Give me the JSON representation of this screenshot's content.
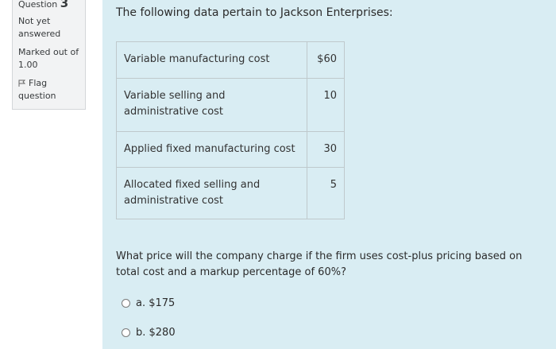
{
  "info": {
    "question_label": "Question",
    "question_number": "3",
    "state_line1": "Not yet",
    "state_line2": "answered",
    "grade_line1": "Marked out of",
    "grade_line2": "1.00",
    "flag_line1": "Flag",
    "flag_line2": "question",
    "flag_icon": "flag-icon"
  },
  "content": {
    "intro": "The following data pertain to Jackson Enterprises:",
    "table": [
      {
        "label": "Variable manufacturing cost",
        "value": "$60"
      },
      {
        "label": "Variable selling and administrative cost",
        "value": "10"
      },
      {
        "label": "Applied fixed manufacturing cost",
        "value": "30"
      },
      {
        "label": "Allocated fixed selling and administrative cost",
        "value": "5"
      }
    ],
    "question": "What price will the company charge if the firm uses cost-plus pricing based on total cost and a markup percentage of 60%?",
    "options": [
      {
        "label": "a. $175"
      },
      {
        "label": "b. $280"
      }
    ]
  },
  "colors": {
    "content_bg": "#d9edf3",
    "info_bg": "#f2f3f4"
  }
}
